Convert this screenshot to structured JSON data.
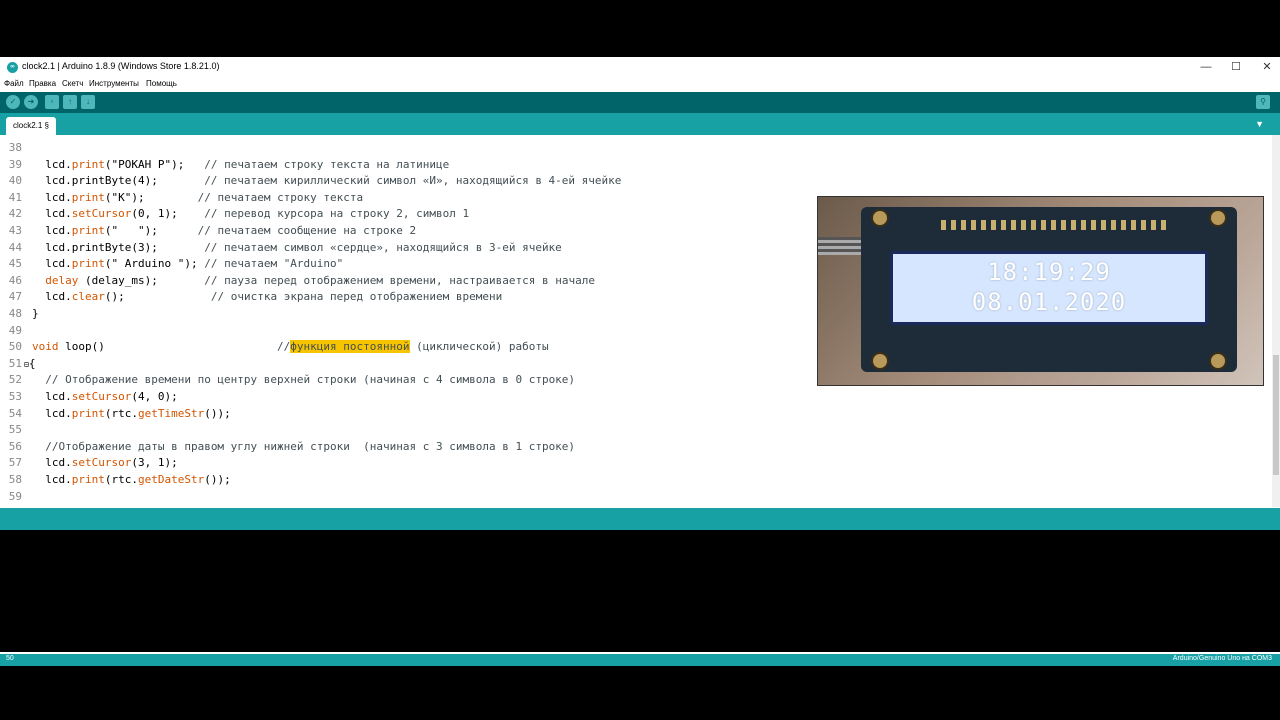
{
  "window": {
    "title": "clock2.1 | Arduino 1.8.9 (Windows Store 1.8.21.0)",
    "icon_text": "∞",
    "controls": {
      "minimize": "—",
      "maximize": "☐",
      "close": "✕"
    }
  },
  "menu": [
    "Файл",
    "Правка",
    "Скетч",
    "Инструменты",
    "Помощь"
  ],
  "toolbar": {
    "verify_icon": "check-icon",
    "upload_icon": "arrow-right-icon",
    "new_icon": "new-file-icon",
    "open_icon": "arrow-up-icon",
    "save_icon": "arrow-down-icon",
    "serial_monitor_icon": "magnifier-icon"
  },
  "tab": {
    "label": "clock2.1 §",
    "menu_glyph": "▼"
  },
  "code": {
    "lines": [
      {
        "num": "38",
        "text": ""
      },
      {
        "num": "39",
        "code": "  lcd.",
        "fn": "print",
        "rest": "(\"PОКАН P\");   ",
        "comment": "// печатаем строку текста на латинице"
      },
      {
        "num": "40",
        "code": "  lcd.printByte(4);       ",
        "fn": "",
        "rest": "",
        "comment": "// печатаем кириллический символ «И», находящийся в 4-ей ячейке"
      },
      {
        "num": "41",
        "code": "  lcd.",
        "fn": "print",
        "rest": "(\"K\");        ",
        "comment": "// печатаем строку текста"
      },
      {
        "num": "42",
        "code": "  lcd.",
        "fn": "setCursor",
        "rest": "(0, 1);    ",
        "comment": "// перевод курсора на строку 2, символ 1"
      },
      {
        "num": "43",
        "code": "  lcd.",
        "fn": "print",
        "rest": "(\"   \");      ",
        "comment": "// печатаем сообщение на строке 2"
      },
      {
        "num": "44",
        "code": "  lcd.printByte(3);       ",
        "fn": "",
        "rest": "",
        "comment": "// печатаем символ «сердце», находящийся в 3-ей ячейке"
      },
      {
        "num": "45",
        "code": "  lcd.",
        "fn": "print",
        "rest": "(\" Arduino \"); ",
        "comment": "// печатаем \"Arduino\""
      },
      {
        "num": "46",
        "code": "  ",
        "fn": "delay",
        "rest": " (delay_ms);       ",
        "comment": "// пауза перед отображением времени, настраивается в начале"
      },
      {
        "num": "47",
        "code": "  lcd.",
        "fn": "clear",
        "rest": "();             ",
        "comment": "// очистка экрана перед отображением времени"
      },
      {
        "num": "48",
        "text": "}"
      },
      {
        "num": "49",
        "text": ""
      },
      {
        "num": "50",
        "special": "loop"
      },
      {
        "num": "51",
        "text": "{"
      },
      {
        "num": "52",
        "code": "  ",
        "fn": "",
        "rest": "",
        "comment": "// Отображение времени по центру верхней строки (начиная с 4 символа в 0 строке)"
      },
      {
        "num": "53",
        "code": "  lcd.",
        "fn": "setCursor",
        "rest": "(4, 0);",
        "comment": ""
      },
      {
        "num": "54",
        "code": "  lcd.",
        "fn": "print",
        "rest": "(rtc.",
        "fn2": "getTimeStr",
        "rest2": "());"
      },
      {
        "num": "55",
        "text": ""
      },
      {
        "num": "56",
        "code": "  ",
        "fn": "",
        "rest": "",
        "comment": "//Отображение даты в правом углу нижней строки  (начиная с 3 символа в 1 строке)"
      },
      {
        "num": "57",
        "code": "  lcd.",
        "fn": "setCursor",
        "rest": "(3, 1);",
        "comment": ""
      },
      {
        "num": "58",
        "code": "  lcd.",
        "fn": "print",
        "rest": "(rtc.",
        "fn2": "getDateStr",
        "rest2": "());"
      },
      {
        "num": "59",
        "text": ""
      }
    ],
    "loop_line": {
      "keyword": "void",
      "name": " loop()",
      "pad": "                          //",
      "highlight": "функция постоянной",
      "after": " (циклической) работы"
    },
    "fold_marker": "⊟"
  },
  "photo": {
    "time": "18:19:29",
    "date": "08.01.2020"
  },
  "footer": {
    "line_number": "50",
    "board": "Arduino/Genuino Uno на COM3"
  }
}
